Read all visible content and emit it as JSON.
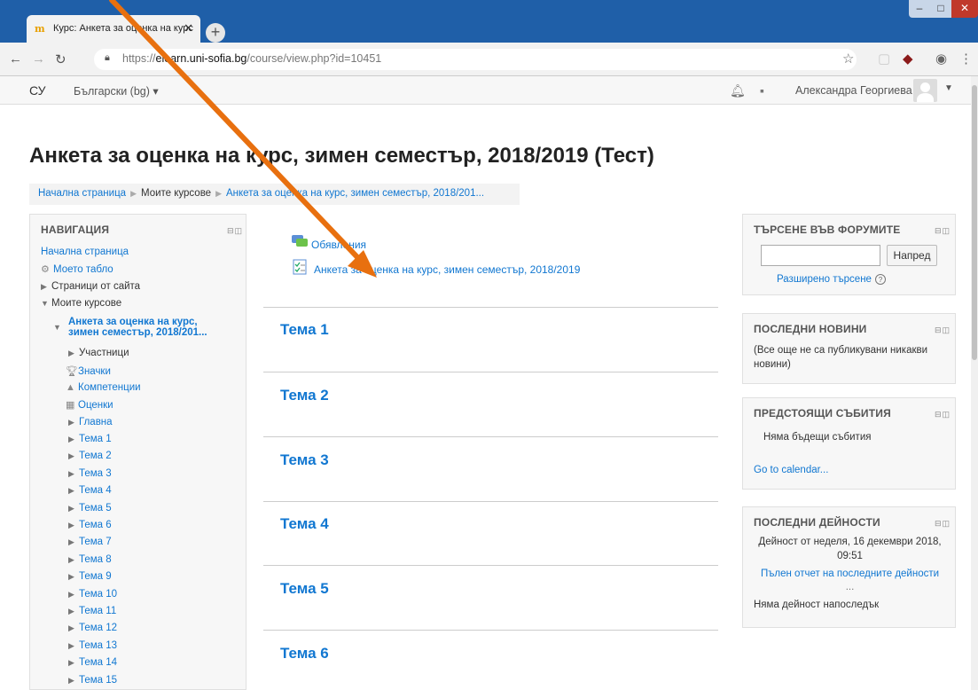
{
  "browser": {
    "tab_title": "Курс: Анкета за оценка на курс",
    "url_scheme": "https://",
    "url_host": "elearn.uni-sofia.bg",
    "url_path": "/course/view.php?id=10451"
  },
  "navbar": {
    "site_short": "СУ",
    "language": "Български (bg) ▾",
    "user_name": "Александра Георгиева"
  },
  "page": {
    "title": "Анкета за оценка на курс, зимен семестър, 2018/2019 (Тест)",
    "breadcrumb": [
      "Начална страница",
      "Моите курсове",
      "Анкета за оценка на курс, зимен семестър, 2018/201..."
    ]
  },
  "navigation": {
    "title": "НАВИГАЦИЯ",
    "home": "Начална страница",
    "dashboard": "Моето табло",
    "site_pages": "Страници от сайта",
    "my_courses": "Моите курсове",
    "course_line1": "Анкета за оценка на курс,",
    "course_line2": "зимен семестър, 2018/201...",
    "participants": "Участници",
    "badges": "Значки",
    "competencies": "Компетенции",
    "grades": "Оценки",
    "general": "Главна",
    "topics": [
      "Тема 1",
      "Тема 2",
      "Тема 3",
      "Тема 4",
      "Тема 5",
      "Тема 6",
      "Тема 7",
      "Тема 8",
      "Тема 9",
      "Тема 10",
      "Тема 11",
      "Тема 12",
      "Тема 13",
      "Тема 14",
      "Тема 15"
    ]
  },
  "main": {
    "activities": [
      "Обявления",
      "Анкета за оценка на курс, зимен семестър, 2018/2019"
    ],
    "sections": [
      "Тема 1",
      "Тема 2",
      "Тема 3",
      "Тема 4",
      "Тема 5",
      "Тема 6"
    ]
  },
  "forum_search": {
    "title": "ТЪРСЕНЕ ВЪВ ФОРУМИТЕ",
    "button": "Напред",
    "advanced": "Разширено търсене"
  },
  "latest_news": {
    "title": "ПОСЛЕДНИ НОВИНИ",
    "text_line1": "(Все още не са публикувани никакви",
    "text_line2": "новини)"
  },
  "upcoming_events": {
    "title": "ПРЕДСТОЯЩИ СЪБИТИЯ",
    "text": "Няма бъдещи събития",
    "link": "Go to calendar..."
  },
  "recent_activity": {
    "title": "ПОСЛЕДНИ ДЕЙНОСТИ",
    "since_line1": "Дейност от неделя, 16 декември 2018,",
    "since_line2": "09:51",
    "report_line1": "Пълен отчет на последните дейности",
    "report_line2": "...",
    "none": "Няма дейност напоследък"
  },
  "colors": {
    "link": "#1177d1",
    "chrome": "#1f5fa8",
    "arrow": "#e8700f"
  }
}
